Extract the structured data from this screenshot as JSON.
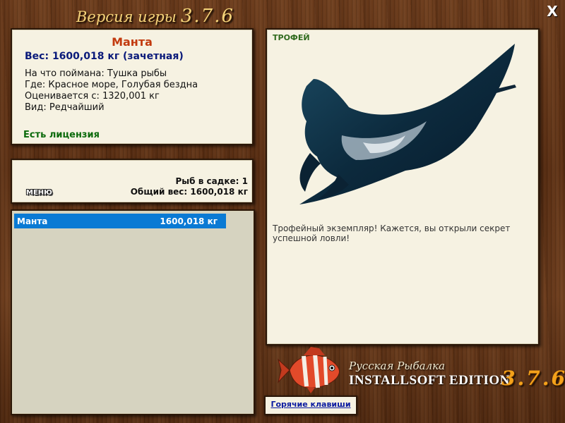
{
  "header": {
    "title": "Версия игры",
    "version": "3.7.6",
    "close_label": "X"
  },
  "fish_info": {
    "name": "Манта",
    "weight_line": "Вес: 1600,018 кг (зачетная)",
    "caught_on": "На что поймана: Тушка рыбы",
    "location": "Где: Красное море, Голубая бездна",
    "valued_from": "Оценивается с: 1320,001 кг",
    "rarity": "Вид: Редчайший",
    "license": "Есть лицензия"
  },
  "keepnet": {
    "menu_label": "МЕНЮ",
    "count_line": "Рыб в садке: 1",
    "total_weight_line": "Общий вес: 1600,018 кг"
  },
  "catch_list": {
    "rows": [
      {
        "name": "Манта",
        "weight": "1600,018 кг"
      }
    ]
  },
  "trophy_panel": {
    "label": "ТРОФЕЙ",
    "image_icon": "manta-ray-icon",
    "description": "Трофейный экземпляр! Кажется, вы открыли секрет успешной ловли!"
  },
  "logo": {
    "line1": "Русская Рыбалка",
    "line2": "INSTALLSOFT EDITION",
    "version": "3.7.6",
    "icon": "red-fish-icon"
  },
  "footer": {
    "hotkeys_label": "Горячие клавиши"
  },
  "colors": {
    "wood": "#5a2e12",
    "panel": "#f6f2e2",
    "fish_name": "#c23a0e",
    "weight": "#0a1a7a",
    "license": "#0b6a0b",
    "selection": "#0a7ad4",
    "logo_version": "#f4a21a",
    "title": "#f4d37a"
  }
}
